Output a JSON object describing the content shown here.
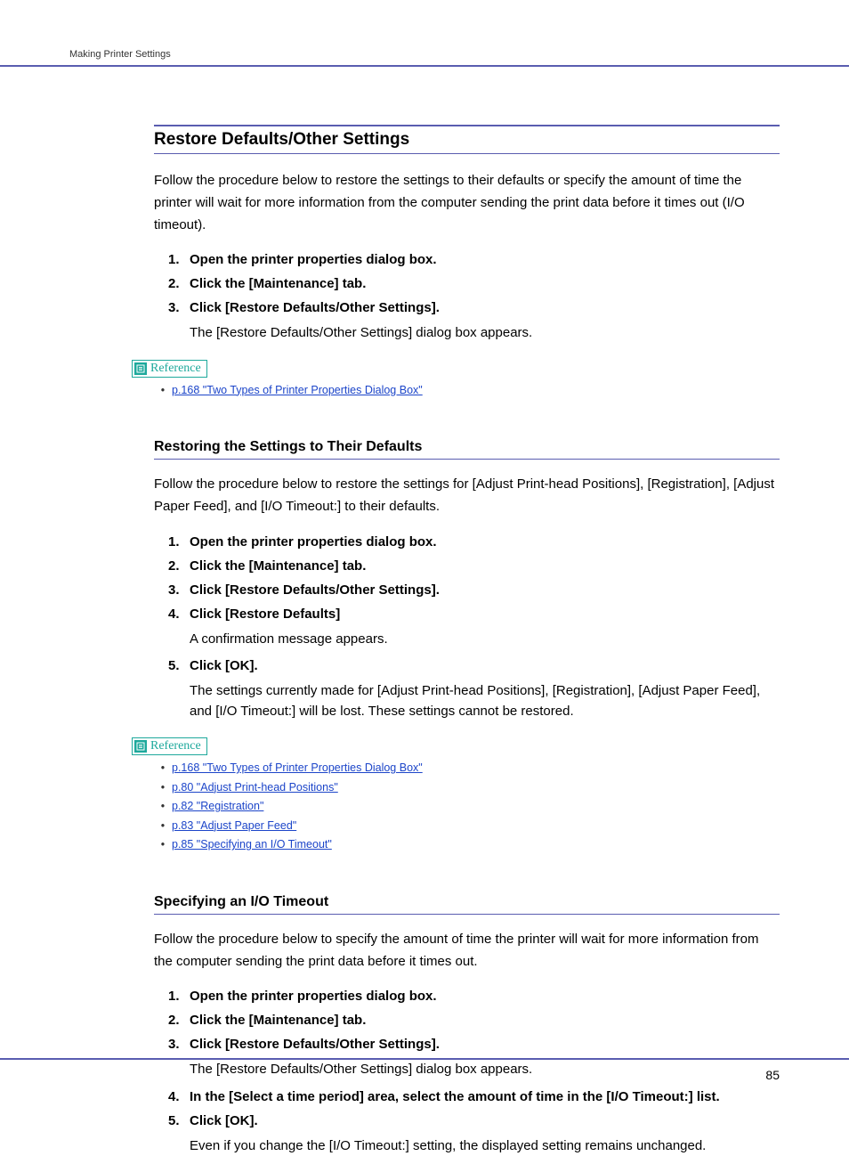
{
  "header": {
    "breadcrumb": "Making Printer Settings"
  },
  "section1": {
    "title": "Restore Defaults/Other Settings",
    "intro": "Follow the procedure below to restore the settings to their defaults or specify the amount of time the printer will wait for more information from the computer sending the print data before it times out (I/O timeout).",
    "steps": [
      {
        "num": "1.",
        "title": "Open the printer properties dialog box."
      },
      {
        "num": "2.",
        "title": "Click the [Maintenance] tab."
      },
      {
        "num": "3.",
        "title": "Click [Restore Defaults/Other Settings].",
        "note": "The [Restore Defaults/Other Settings] dialog box appears."
      }
    ],
    "reference_label": "Reference",
    "refs": [
      {
        "text": "p.168 \"Two Types of Printer Properties Dialog Box\""
      }
    ]
  },
  "section2": {
    "title": "Restoring the Settings to Their Defaults",
    "intro": "Follow the procedure below to restore the settings for [Adjust Print-head Positions], [Registration], [Adjust Paper Feed], and [I/O Timeout:] to their defaults.",
    "steps": [
      {
        "num": "1.",
        "title": "Open the printer properties dialog box."
      },
      {
        "num": "2.",
        "title": "Click the [Maintenance] tab."
      },
      {
        "num": "3.",
        "title": "Click [Restore Defaults/Other Settings]."
      },
      {
        "num": "4.",
        "title": "Click [Restore Defaults]",
        "note": "A confirmation message appears."
      },
      {
        "num": "5.",
        "title": "Click [OK].",
        "note": "The settings currently made for [Adjust Print-head Positions], [Registration], [Adjust Paper Feed], and [I/O Timeout:] will be lost. These settings cannot be restored."
      }
    ],
    "reference_label": "Reference",
    "refs": [
      {
        "text": "p.168 \"Two Types of Printer Properties Dialog Box\""
      },
      {
        "text": "p.80 \"Adjust Print-head Positions\""
      },
      {
        "text": "p.82 \"Registration\""
      },
      {
        "text": "p.83 \"Adjust Paper Feed\""
      },
      {
        "text": "p.85 \"Specifying an I/O Timeout\""
      }
    ]
  },
  "section3": {
    "title": "Specifying an I/O Timeout",
    "intro": "Follow the procedure below to specify the amount of time the printer will wait for more information from the computer sending the print data before it times out.",
    "steps": [
      {
        "num": "1.",
        "title": "Open the printer properties dialog box."
      },
      {
        "num": "2.",
        "title": "Click the [Maintenance] tab."
      },
      {
        "num": "3.",
        "title": "Click [Restore Defaults/Other Settings].",
        "note": "The [Restore Defaults/Other Settings] dialog box appears."
      },
      {
        "num": "4.",
        "title": "In the [Select a time period] area, select the amount of time in the [I/O Timeout:] list."
      },
      {
        "num": "5.",
        "title": "Click [OK].",
        "note": "Even if you change the [I/O Timeout:] setting, the displayed setting remains unchanged."
      }
    ]
  },
  "page_number": "85"
}
